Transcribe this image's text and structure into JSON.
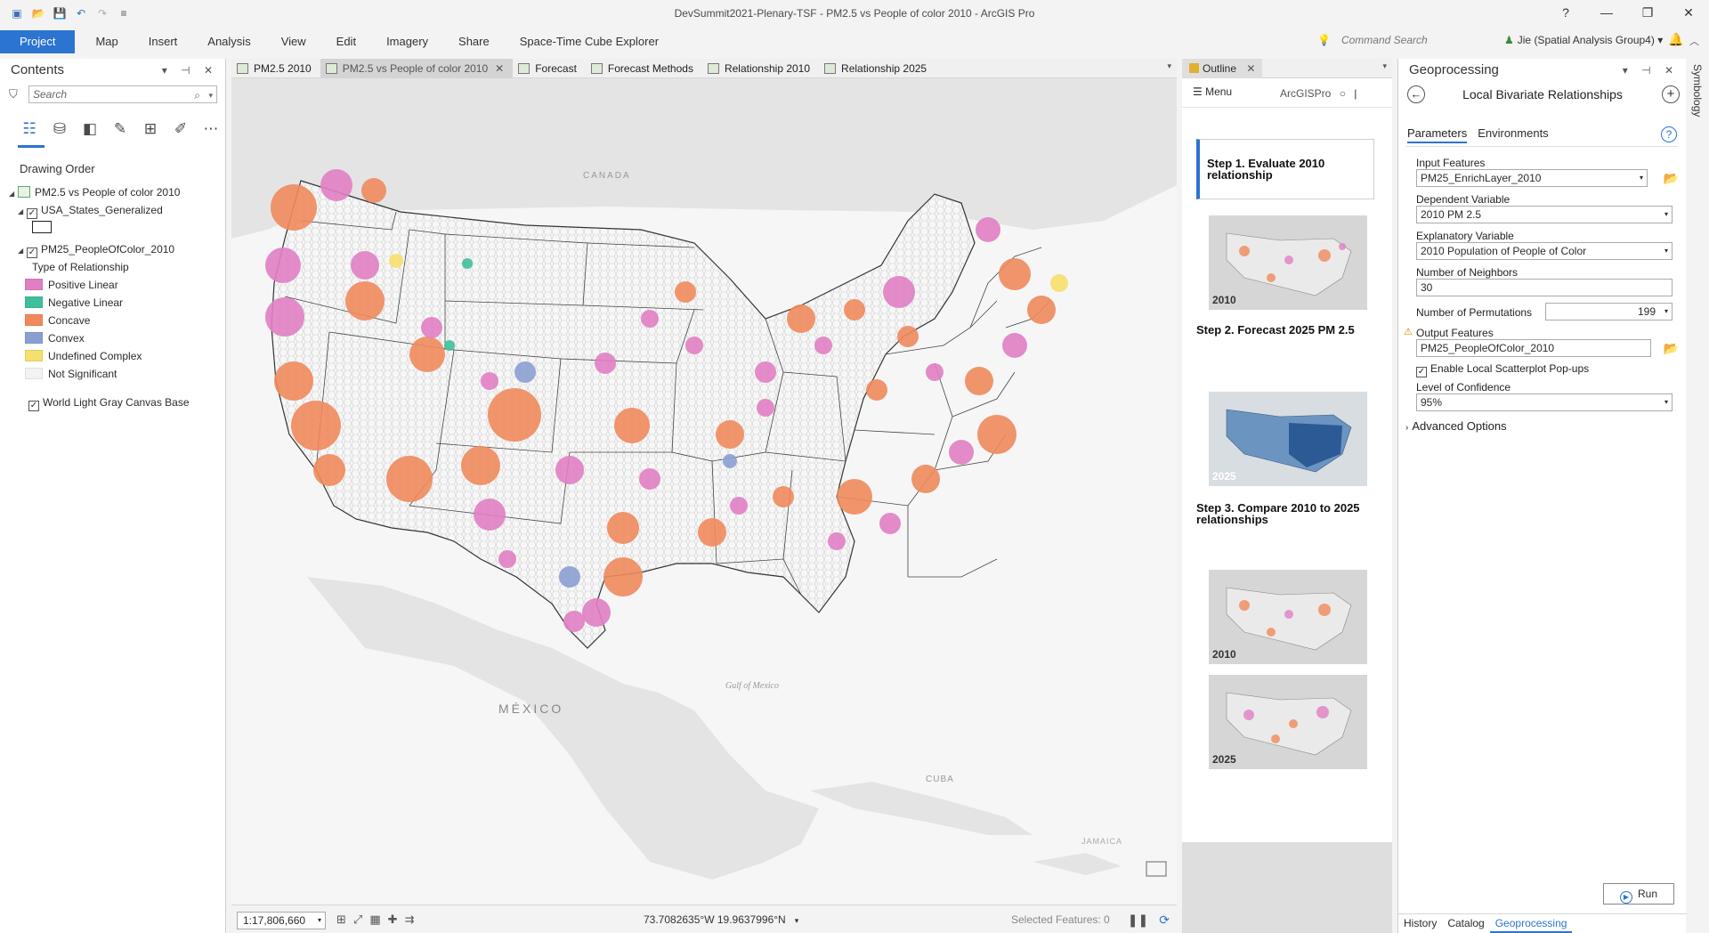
{
  "window": {
    "title": "DevSummit2021-Plenary-TSF - PM2.5 vs People of color 2010 - ArcGIS Pro",
    "help": "?",
    "minimize": "—",
    "restore": "❐",
    "close": "✕"
  },
  "quick_access": [
    "new",
    "open",
    "save",
    "undo",
    "redo",
    "customize"
  ],
  "ribbon": {
    "tabs": [
      "Project",
      "Map",
      "Insert",
      "Analysis",
      "View",
      "Edit",
      "Imagery",
      "Share",
      "Space-Time Cube Explorer"
    ],
    "command_search_placeholder": "Command Search",
    "user": "Jie (Spatial Analysis Group4)",
    "user_dd": "▾"
  },
  "contents": {
    "title": "Contents",
    "pane_controls": "▾ ⊣ ✕",
    "search_placeholder": "Search",
    "drawing_order_label": "Drawing Order",
    "map_name": "PM2.5 vs People of color 2010",
    "layer_states": "USA_States_Generalized",
    "layer_hex": "PM25_PeopleOfColor_2010",
    "legend_title": "Type of Relationship",
    "legend": [
      {
        "label": "Positive Linear",
        "color": "#e07fc3"
      },
      {
        "label": "Negative Linear",
        "color": "#3fbf9b"
      },
      {
        "label": "Concave",
        "color": "#f08a5d"
      },
      {
        "label": "Convex",
        "color": "#8a9fd1"
      },
      {
        "label": "Undefined Complex",
        "color": "#f7df6d"
      },
      {
        "label": "Not Significant",
        "color": "#f3f3f3"
      }
    ],
    "basemap": "World Light Gray Canvas Base"
  },
  "view_tabs": [
    {
      "label": "PM2.5 2010",
      "active": false
    },
    {
      "label": "PM2.5 vs People of color 2010",
      "active": true,
      "close": "✕"
    },
    {
      "label": "Forecast",
      "active": false
    },
    {
      "label": "Forecast Methods",
      "active": false
    },
    {
      "label": "Relationship 2010",
      "active": false
    },
    {
      "label": "Relationship 2025",
      "active": false
    }
  ],
  "map": {
    "labels": {
      "canada": "CANADA",
      "mexico": "MÉXICO",
      "gulf": "Gulf of Mexico",
      "cuba": "CUBA",
      "jamaica": "JAMAICA"
    },
    "colors": {
      "water": "#f6f6f6",
      "land": "#e4e4e4",
      "grid": "#f7f7f7"
    }
  },
  "status": {
    "scale": "1:17,806,660",
    "coords": "73.7082635°W 19.9637996°N",
    "selected": "Selected Features: 0"
  },
  "outline": {
    "tab": "Outline",
    "close": "✕",
    "menu": "☰ Menu",
    "brand": "ArcGISPro",
    "steps": [
      {
        "title": "Step 1. Evaluate 2010 relationship",
        "thumb_label": "2010"
      },
      {
        "title": "Step 2. Forecast 2025 PM 2.5",
        "thumb_label": "2025"
      },
      {
        "title": "Step 3. Compare 2010 to 2025 relationships",
        "thumb_label": "2010",
        "thumb_label2": "2025"
      }
    ]
  },
  "geoprocessing": {
    "title": "Geoprocessing",
    "tool": "Local Bivariate Relationships",
    "tabs": [
      "Parameters",
      "Environments"
    ],
    "params": {
      "input_features_label": "Input Features",
      "input_features": "PM25_EnrichLayer_2010",
      "dependent_label": "Dependent Variable",
      "dependent": "2010 PM 2.5",
      "explanatory_label": "Explanatory Variable",
      "explanatory": "2010 Population of People of Color",
      "neighbors_label": "Number of Neighbors",
      "neighbors": "30",
      "permutations_label": "Number of Permutations",
      "permutations": "199",
      "output_label": "Output Features",
      "output": "PM25_PeopleOfColor_2010",
      "popups_label": "Enable Local Scatterplot Pop-ups",
      "confidence_label": "Level of Confidence",
      "confidence": "95%",
      "advanced": "Advanced Options"
    },
    "run": "Run",
    "bottom_tabs": [
      "History",
      "Catalog",
      "Geoprocessing"
    ]
  },
  "symbology_tab": "Symbology"
}
